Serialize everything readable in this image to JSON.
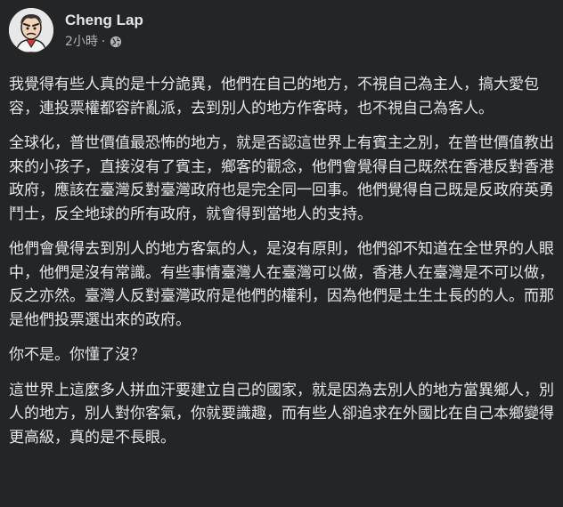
{
  "post": {
    "author": "Cheng Lap",
    "timestamp": "2小時",
    "separator": "·",
    "privacy_icon": "globe-icon",
    "avatar_icon": "cartoon-character-avatar",
    "paragraphs": [
      "我覺得有些人真的是十分詭異，他們在自己的地方，不視自己為主人，搞大愛包容，連投票權都容許亂派，去到別人的地方作客時，也不視自己為客人。",
      "全球化，普世價值最恐怖的地方，就是否認這世界上有賓主之別，在普世價值教出來的小孩子，直接沒有了賓主，鄉客的觀念，他們會覺得自己既然在香港反對香港政府，應該在臺灣反對臺灣政府也是完全同一回事。他們覺得自己既是反政府英勇鬥士，反全地球的所有政府，就會得到當地人的支持。",
      "他們會覺得去到別人的地方客氣的人，是沒有原則，他們卻不知道在全世界的人眼中，他們是沒有常識。有些事情臺灣人在臺灣可以做，香港人在臺灣是不可以做，反之亦然。臺灣人反對臺灣政府是他們的權利，因為他們是土生土長的的人。而那是他們投票選出來的政府。",
      "你不是。你懂了沒？",
      "這世界上這麼多人拼血汗要建立自己的國家，就是因為去別人的地方當異鄉人，別人的地方，別人對你客氣，你就要識趣，而有些人卻追求在外國比在自己本鄉變得更高級，真的是不長眼。"
    ]
  },
  "colors": {
    "background": "#242526",
    "primary_text": "#e4e6eb",
    "secondary_text": "#b0b3b8"
  }
}
